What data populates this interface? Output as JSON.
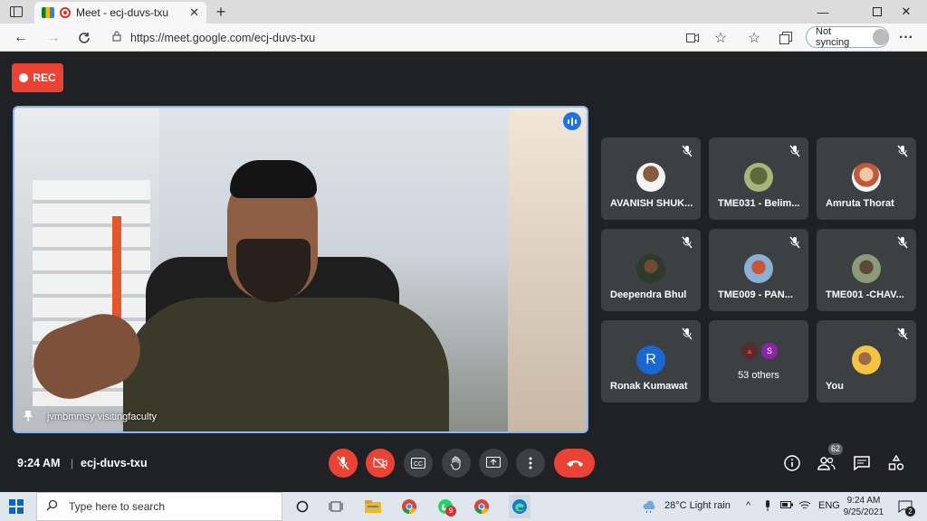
{
  "browser": {
    "tab_title": "Meet - ecj-duvs-txu",
    "url": "https://meet.google.com/ecj-duvs-txu",
    "sync_label": "Not syncing"
  },
  "meet": {
    "rec_label": "REC",
    "main_speaker": "jvmbmmsy visitingfaculty",
    "participants": [
      {
        "name": "AVANISH SHUK..."
      },
      {
        "name": "TME031 - Belim..."
      },
      {
        "name": "Amruta Thorat"
      },
      {
        "name": "Deependra Bhul"
      },
      {
        "name": "TME009 - PAN..."
      },
      {
        "name": "TME001 -CHAV..."
      },
      {
        "name": "Ronak Kumawat",
        "initial": "R"
      },
      {
        "name": "53 others",
        "initial": "S"
      },
      {
        "name": "You"
      }
    ],
    "time": "9:24 AM",
    "separator": "|",
    "meeting_code": "ecj-duvs-txu",
    "people_count": "62"
  },
  "taskbar": {
    "search_placeholder": "Type here to search",
    "whatsapp_badge": "9",
    "weather": "28°C  Light rain",
    "lang": "ENG",
    "time": "9:24 AM",
    "date": "9/25/2021",
    "notif_count": "2"
  }
}
